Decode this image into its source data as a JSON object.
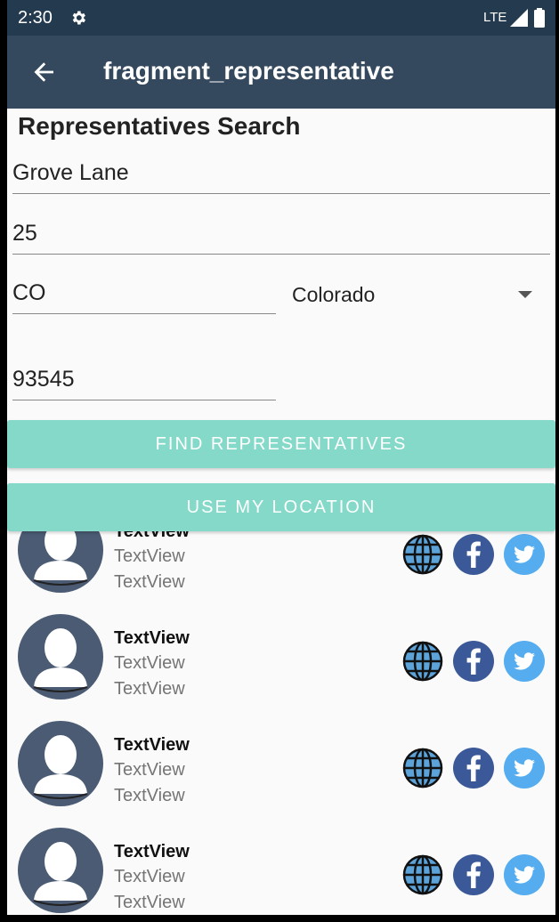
{
  "status_bar": {
    "time": "2:30",
    "network": "LTE",
    "icons": [
      "settings-gear-icon",
      "signal-icon",
      "battery-icon"
    ]
  },
  "app_bar": {
    "title": "fragment_representative",
    "back_icon": "arrow-back-icon"
  },
  "search": {
    "heading": "Representatives Search",
    "street": "Grove Lane",
    "number": "25",
    "state_code": "CO",
    "state_selected": "Colorado",
    "zip": "93545",
    "find_label": "FIND REPRESENTATIVES",
    "location_label": "USE MY LOCATION"
  },
  "colors": {
    "status_bar": "#243a4e",
    "app_bar": "#34495e",
    "button": "#84d9c8",
    "facebook": "#3b5998",
    "twitter": "#55acee",
    "globe": "#5ba3d9",
    "avatar_bg": "#4a5b73"
  },
  "representatives": [
    {
      "name": "TextView",
      "line1": "TextView",
      "line2": "TextView"
    },
    {
      "name": "TextView",
      "line1": "TextView",
      "line2": "TextView"
    },
    {
      "name": "TextView",
      "line1": "TextView",
      "line2": "TextView"
    },
    {
      "name": "TextView",
      "line1": "TextView",
      "line2": "TextView"
    }
  ]
}
